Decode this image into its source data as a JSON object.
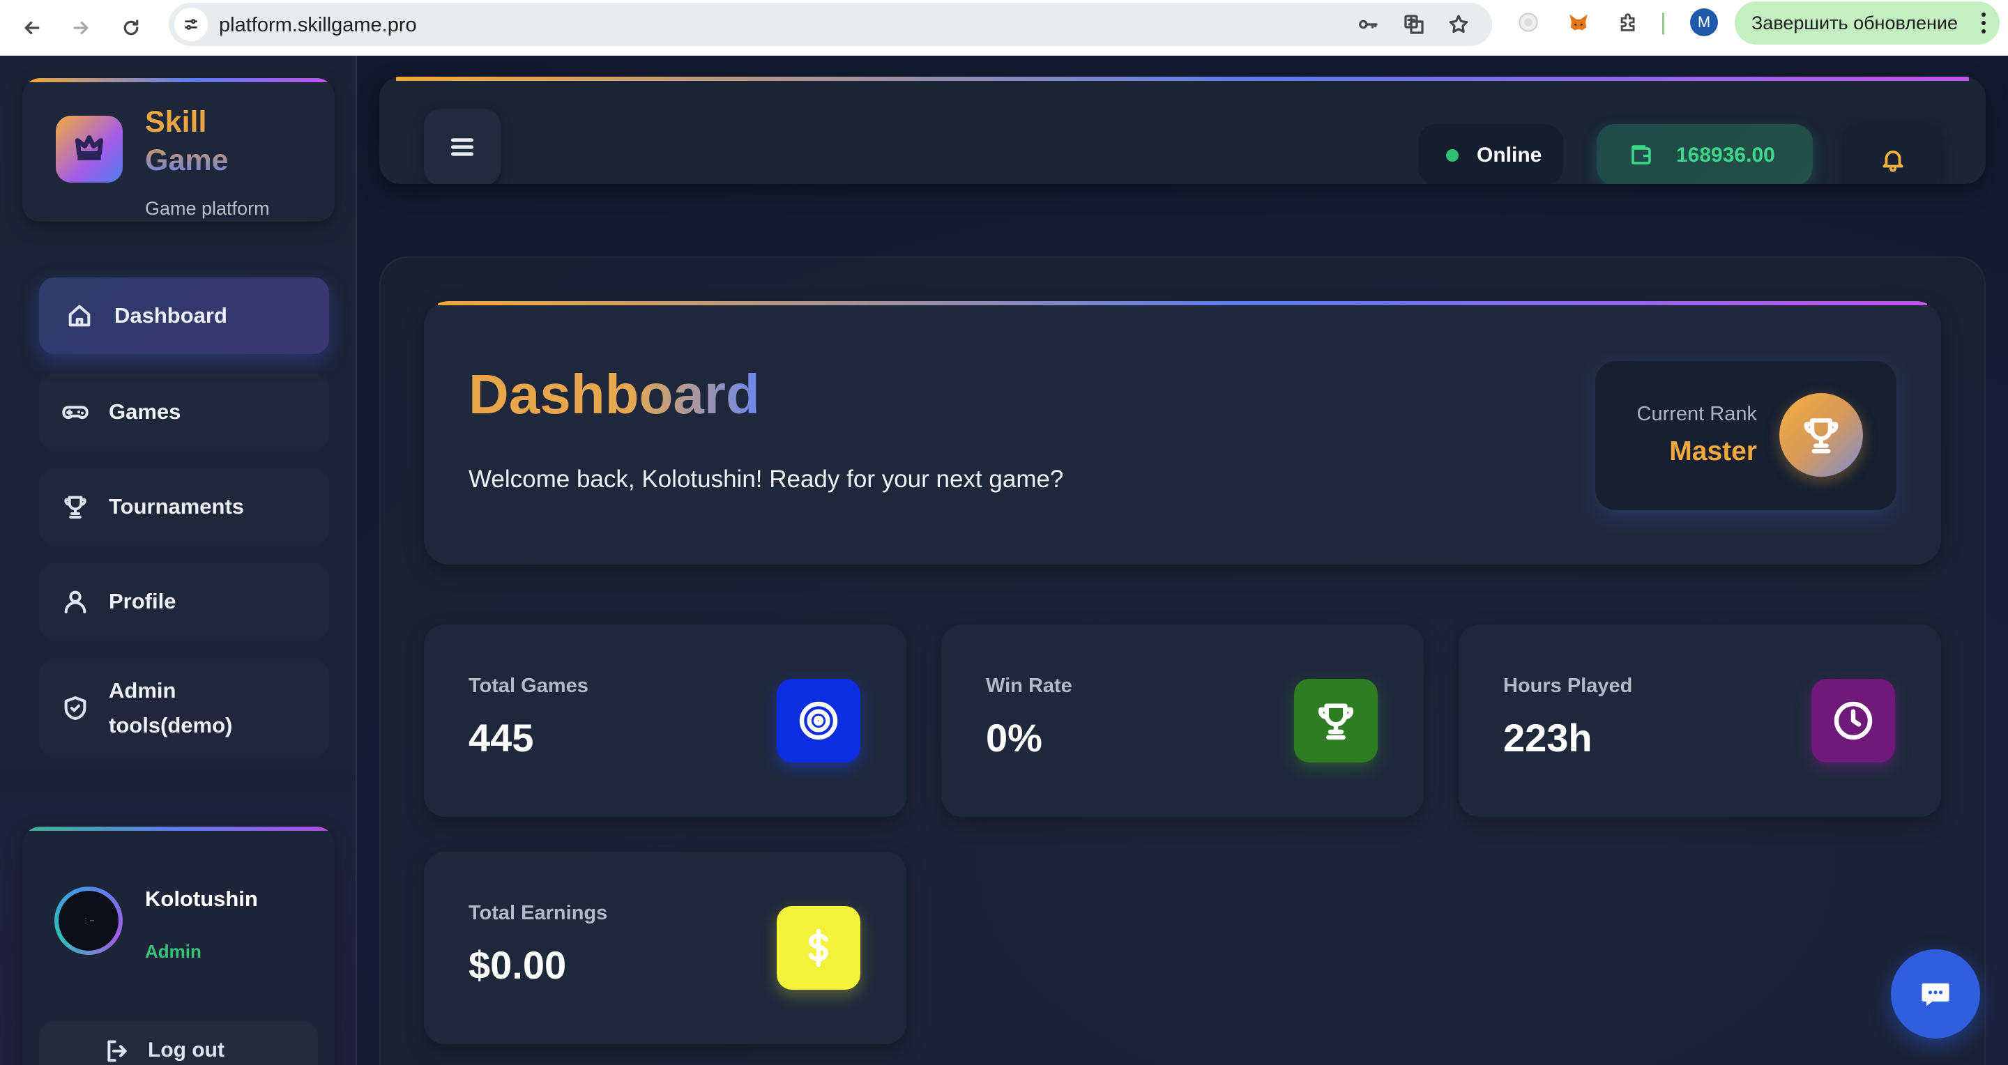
{
  "browser": {
    "url": "platform.skillgame.pro",
    "profile_initial": "M",
    "update_button": "Завершить обновление"
  },
  "brand": {
    "name": "Skill Game",
    "subtitle": "Game platform"
  },
  "sidebar": {
    "items": [
      {
        "label": "Dashboard",
        "icon": "home-icon",
        "active": true
      },
      {
        "label": "Games",
        "icon": "gamepad-icon",
        "active": false
      },
      {
        "label": "Tournaments",
        "icon": "trophy-icon",
        "active": false
      },
      {
        "label": "Profile",
        "icon": "user-icon",
        "active": false
      },
      {
        "label": "Admin tools(demo)",
        "icon": "shield-check-icon",
        "active": false
      }
    ],
    "user": {
      "name": "Kolotushin",
      "role": "Admin",
      "logout_label": "Log out"
    }
  },
  "header": {
    "status": "Online",
    "balance": "168936.00"
  },
  "dashboard": {
    "title": "Dashboard",
    "welcome": "Welcome back, Kolotushin! Ready for your next game?",
    "rank_label": "Current Rank",
    "rank_value": "Master",
    "stats": [
      {
        "label": "Total Games",
        "value": "445",
        "icon": "target-icon",
        "color": "#0a2ee0"
      },
      {
        "label": "Win Rate",
        "value": "0%",
        "icon": "trophy-icon",
        "color": "#2f7d22"
      },
      {
        "label": "Hours Played",
        "value": "223h",
        "icon": "clock-icon",
        "color": "#6f1a7a"
      },
      {
        "label": "Total Earnings",
        "value": "$0.00",
        "icon": "dollar-icon",
        "color": "#f2f23a"
      }
    ]
  },
  "colors": {
    "accent_gold": "#f2a93b",
    "accent_blue": "#5c7bf0",
    "online_green": "#2fc075",
    "chat_blue": "#2f5fdc"
  }
}
